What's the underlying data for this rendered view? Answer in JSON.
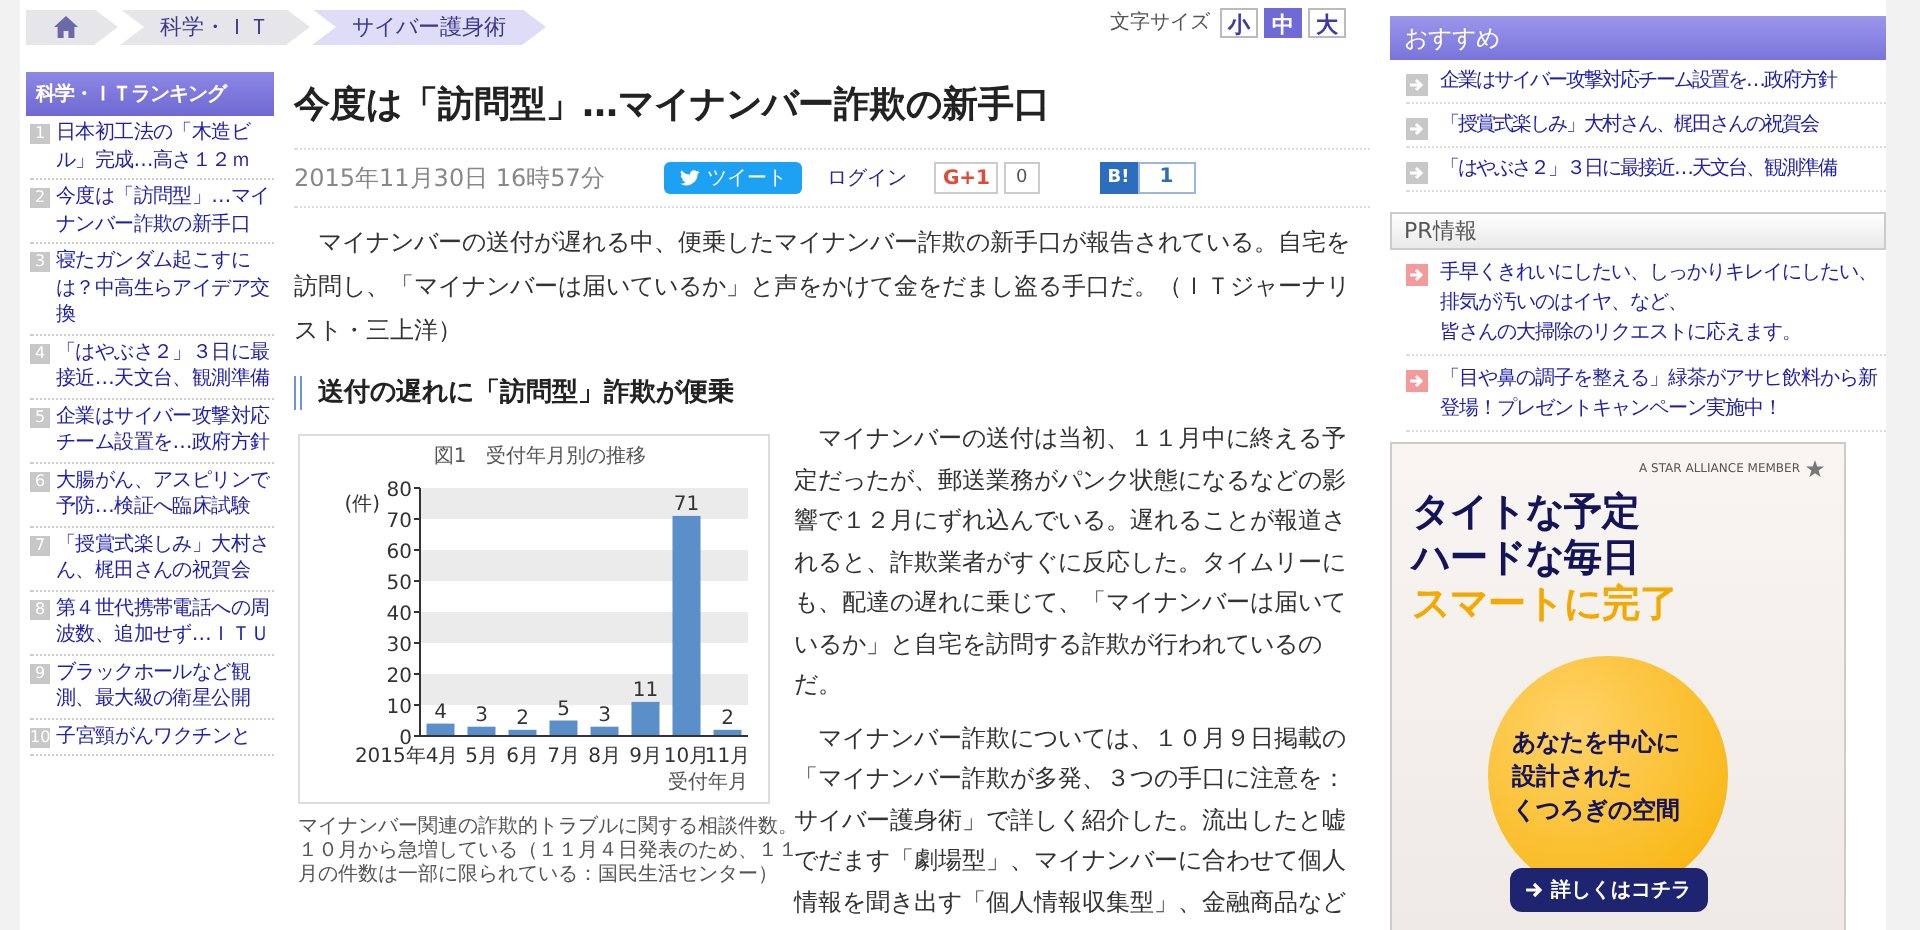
{
  "breadcrumb": {
    "items": [
      {
        "kind": "home"
      },
      {
        "kind": "link",
        "label": "科学・ＩＴ"
      },
      {
        "kind": "current",
        "label": "サイバー護身術"
      }
    ]
  },
  "font_size": {
    "label": "文字サイズ",
    "options": [
      {
        "label": "小",
        "selected": false
      },
      {
        "label": "中",
        "selected": true
      },
      {
        "label": "大",
        "selected": false
      }
    ]
  },
  "ranking": {
    "title": "科学・ＩＴランキング",
    "items": [
      {
        "rank": "1",
        "title": "日本初工法の「木造ビル」完成…高さ１２ｍ"
      },
      {
        "rank": "2",
        "title": "今度は「訪問型」…マイナンバー詐欺の新手口"
      },
      {
        "rank": "3",
        "title": "寝たガンダム起こすには？中高生らアイデア交換"
      },
      {
        "rank": "4",
        "title": "「はやぶさ２」３日に最接近…天文台、観測準備"
      },
      {
        "rank": "5",
        "title": "企業はサイバー攻撃対応チーム設置を…政府方針"
      },
      {
        "rank": "6",
        "title": "大腸がん、アスピリンで予防…検証へ臨床試験"
      },
      {
        "rank": "7",
        "title": "「授賞式楽しみ」大村さん、梶田さんの祝賀会"
      },
      {
        "rank": "8",
        "title": "第４世代携帯電話への周波数、追加せず…ＩＴＵ"
      },
      {
        "rank": "9",
        "title": "ブラックホールなど観測、最大級の衛星公開"
      },
      {
        "rank": "10",
        "title": "子宮頸がんワクチンと"
      }
    ]
  },
  "article": {
    "title": "今度は「訪問型」…マイナンバー詐欺の新手口",
    "date": "2015年11月30日 16時57分",
    "share": {
      "tweet": "ツイート",
      "login": "ログイン",
      "gplus": "G+1",
      "gplus_count": "0",
      "hatena": "B!",
      "hatena_count": "1"
    },
    "lead": "　マイナンバーの送付が遅れる中、便乗したマイナンバー詐欺の新手口が報告されている。自宅を訪問し、「マイナンバーは届いているか」と声をかけて金をだまし盗る手口だ。（ＩＴジャーナリスト・三上洋）",
    "heading": "送付の遅れに「訪問型」詐欺が便乗",
    "figure": {
      "chart_data": {
        "type": "bar",
        "title": "図1　受付年月別の推移",
        "xlabel": "受付年月",
        "ylabel": "(件)",
        "categories": [
          "2015年4月",
          "5月",
          "6月",
          "7月",
          "8月",
          "9月",
          "10月",
          "11月"
        ],
        "series": [
          {
            "color": "#5b8fc9",
            "values": [
              4,
              3,
              2,
              5,
              3,
              11,
              71,
              2
            ]
          }
        ],
        "ylim": [
          0,
          80
        ],
        "yticks": [
          0,
          10,
          20,
          30,
          40,
          50,
          60,
          70,
          80
        ],
        "data_labels": true
      },
      "caption": "マイナンバー関連の詐欺的トラブルに関する相談件数。１０月から急増している（１１月４日発表のため、１１月の件数は一部に限られている：国民生活センター）"
    },
    "paragraphs": [
      "　マイナンバーの送付は当初、１１月中に終える予定だったが、郵送業務がパンク状態になるなどの影響で１２月にずれ込んでいる。遅れることが報道されると、詐欺業者がすぐに反応した。タイムリーにも、配達の遅れに乗じて、「マイナンバーは届いているか」と自宅を訪問する詐欺が行われているのだ。",
      "　マイナンバー詐欺については、１０月９日掲載の「マイナンバー詐欺が多発、３つの手口に注意を：サイバー護身術」で詳しく紹介した。流出したと嘘でだます「劇場型」、マイナンバーに合わせて個人情報を聞き出す「個人情報収集型」、金融商品など"
    ]
  },
  "recommend": {
    "title": "おすすめ",
    "items": [
      "企業はサイバー攻撃対応チーム設置を…政府方針",
      "「授賞式楽しみ」大村さん、梶田さんの祝賀会",
      "「はやぶさ２」３日に最接近…天文台、観測準備"
    ]
  },
  "pr": {
    "title": "PR情報",
    "items": [
      [
        "手早くきれいにしたい、しっかりキレイにしたい、排気が汚いのはイヤ、など、",
        "皆さんの大掃除のリクエストに応えます。"
      ],
      [
        "「目や鼻の調子を整える」緑茶がアサヒ飲料から新登場！プレゼントキャンペーン実施中！"
      ]
    ]
  },
  "ad": {
    "badge": "A STAR ALLIANCE MEMBER",
    "headline": [
      "タイトな予定",
      "ハードな毎日"
    ],
    "highlight": "スマートに完了",
    "circle": [
      "あなたを中心に",
      "設計された",
      "くつろぎの空間"
    ],
    "button": "詳しくはコチラ"
  }
}
